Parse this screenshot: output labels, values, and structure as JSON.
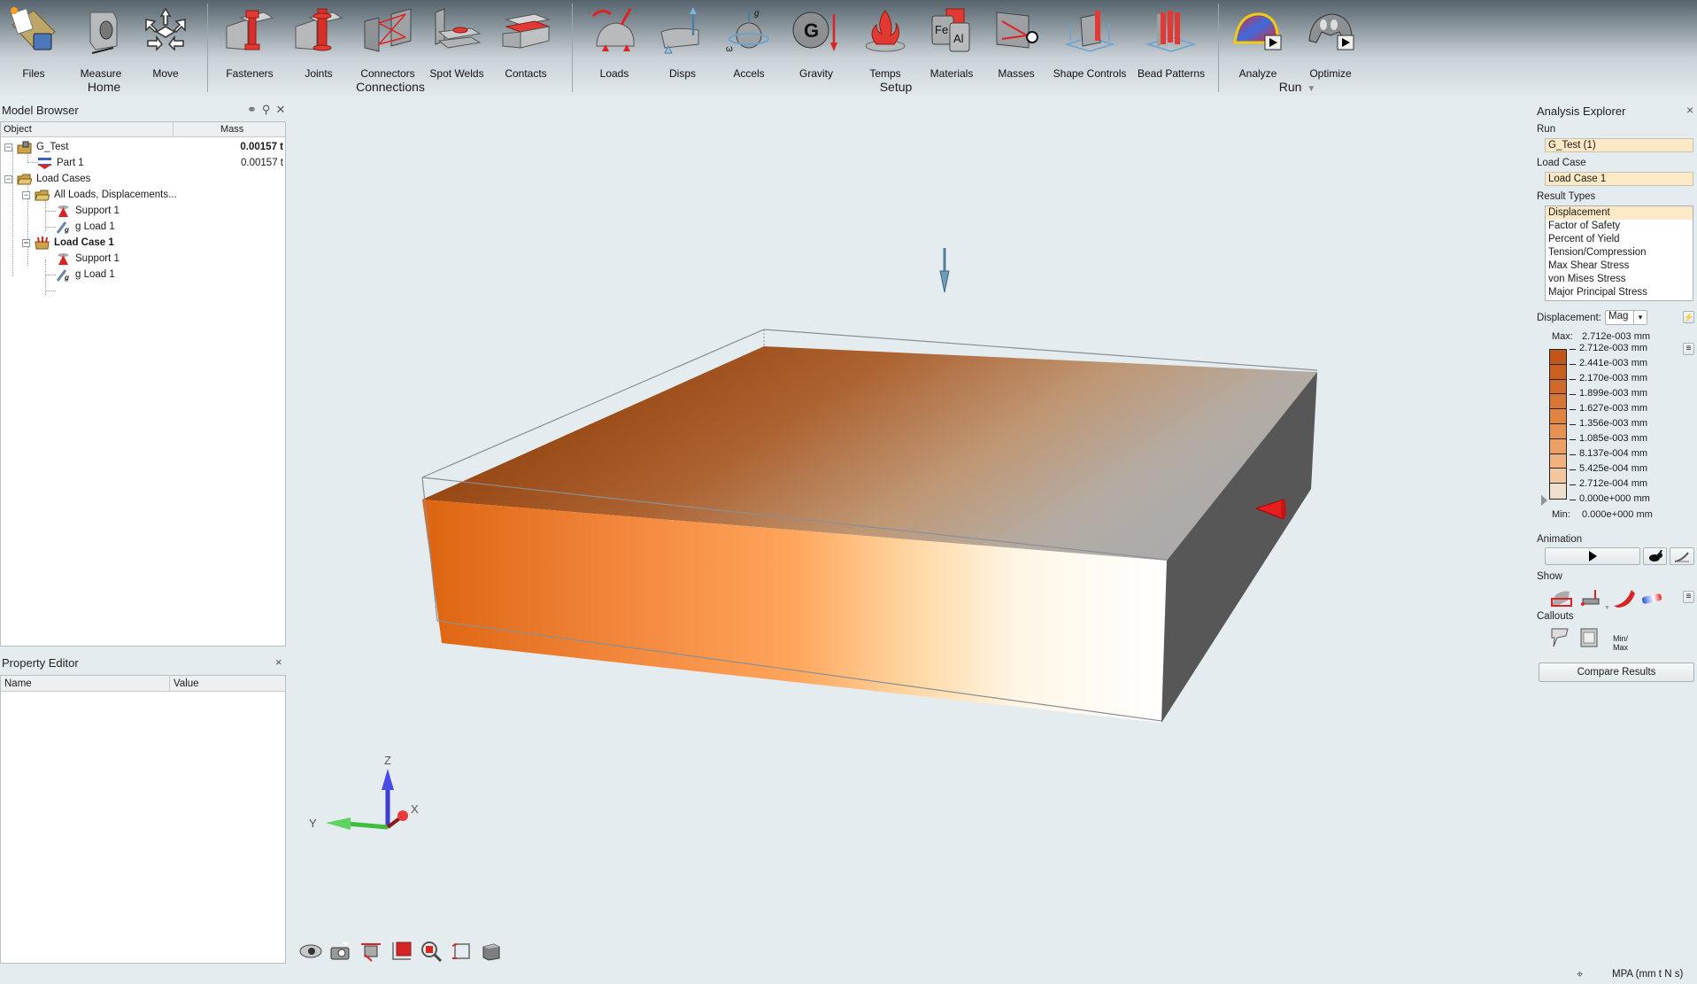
{
  "ribbon": {
    "groups": [
      {
        "label": "Home",
        "tools": [
          "Files",
          "Measure",
          "Move"
        ]
      },
      {
        "label": "Connections",
        "tools": [
          "Fasteners",
          "Joints",
          "Connectors",
          "Spot Welds",
          "Contacts"
        ]
      },
      {
        "label": "Setup",
        "tools": [
          "Loads",
          "Disps",
          "Accels",
          "Gravity",
          "Temps",
          "Materials",
          "Masses",
          "Shape Controls",
          "Bead Patterns"
        ]
      },
      {
        "label": "Run",
        "tools": [
          "Analyze",
          "Optimize"
        ]
      }
    ],
    "run_caret": "▼"
  },
  "model_browser": {
    "title": "Model Browser",
    "icons": [
      "binoculars-icon",
      "search-icon",
      "close-icon"
    ],
    "columns": [
      "Object",
      "Mass"
    ],
    "rows": [
      {
        "label": "G_Test",
        "mass": "0.00157 t",
        "bold_mass": true,
        "icon": "model-folder-icon",
        "level": 0,
        "expander": "−"
      },
      {
        "label": "Part 1",
        "mass": "0.00157 t",
        "icon": "part-icon",
        "level": 1
      },
      {
        "label": "Load Cases",
        "mass": "",
        "icon": "folder-icon",
        "level": 0,
        "expander": "−"
      },
      {
        "label": "All Loads, Displacements...",
        "mass": "",
        "icon": "folder-icon",
        "level": 1,
        "expander": "−"
      },
      {
        "label": "Support 1",
        "mass": "",
        "icon": "support-icon",
        "level": 2
      },
      {
        "label": "g Load 1",
        "mass": "",
        "icon": "gravity-load-icon",
        "level": 2
      },
      {
        "label": "Load Case 1",
        "mass": "",
        "icon": "load-case-icon",
        "level": 1,
        "expander": "−",
        "bold": true
      },
      {
        "label": "Support 1",
        "mass": "",
        "icon": "support-icon",
        "level": 2
      },
      {
        "label": "g Load 1",
        "mass": "",
        "icon": "gravity-load-icon",
        "level": 2
      }
    ]
  },
  "property_editor": {
    "title": "Property Editor",
    "columns": [
      "Name",
      "Value"
    ],
    "close": "×"
  },
  "viewport": {
    "axis_labels": {
      "x": "X",
      "y": "Y",
      "z": "Z"
    },
    "view_tools": [
      "view-eye-icon",
      "camera-icon",
      "section-icon",
      "fit-view-icon",
      "zoom-icon",
      "transparency-icon",
      "cube-view-icon"
    ],
    "colors": {
      "result_max": "#c0530f",
      "result_min": "#ffffff",
      "background": "#e4ecf0"
    }
  },
  "analysis_explorer": {
    "title": "Analysis Explorer",
    "close": "×",
    "run_label": "Run",
    "run_value": "G_Test (1)",
    "load_case_label": "Load Case",
    "load_case_value": "Load Case 1",
    "result_types_label": "Result Types",
    "result_types": [
      "Displacement",
      "Factor of Safety",
      "Percent of Yield",
      "Tension/Compression",
      "Max Shear Stress",
      "von Mises Stress",
      "Major Principal Stress"
    ],
    "selected_result": "Displacement",
    "displacement_label": "Displacement:",
    "component": "Mag",
    "max_label": "Max:",
    "max_value": "2.712e-003 mm",
    "min_label": "Min:",
    "min_value": "0.000e+000 mm",
    "legend_values": [
      "2.712e-003 mm",
      "2.441e-003 mm",
      "2.170e-003 mm",
      "1.899e-003 mm",
      "1.627e-003 mm",
      "1.356e-003 mm",
      "1.085e-003 mm",
      "8.137e-004 mm",
      "5.425e-004 mm",
      "2.712e-004 mm",
      "0.000e+000 mm"
    ],
    "legend_colors": [
      "#c2561a",
      "#c95f21",
      "#d06a2a",
      "#d87636",
      "#e08343",
      "#e79152",
      "#eda065",
      "#f2b27f",
      "#f4c69f",
      "#eedfcf"
    ],
    "animation_label": "Animation",
    "show_label": "Show",
    "callouts_label": "Callouts",
    "minmax_label": "Min/\nMax",
    "compare_button": "Compare Results"
  },
  "status_bar": {
    "units": "MPA (mm t N s)"
  }
}
